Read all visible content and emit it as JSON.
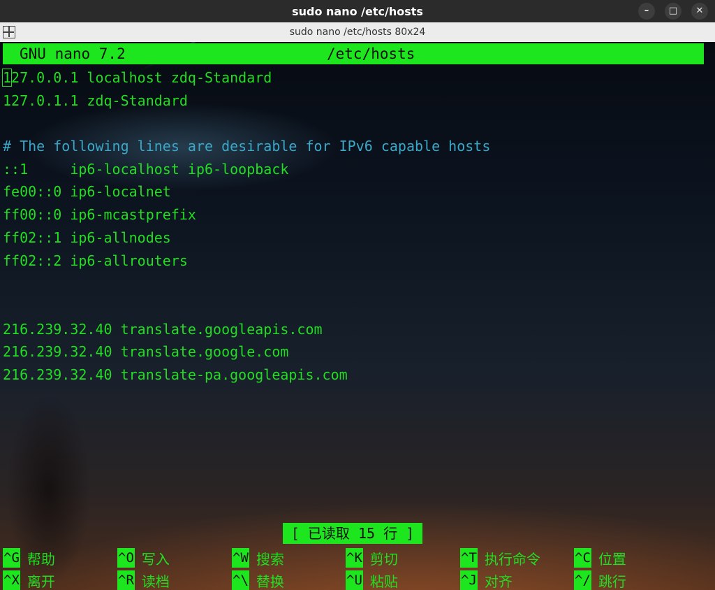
{
  "window": {
    "title": "sudo nano /etc/hosts"
  },
  "tab": {
    "title": "sudo nano /etc/hosts 80x24"
  },
  "nano": {
    "version": "GNU nano 7.2",
    "filename": "/etc/hosts",
    "lines": [
      "127.0.0.1 localhost zdq-Standard",
      "127.0.1.1 zdq-Standard",
      "",
      "# The following lines are desirable for IPv6 capable hosts",
      "::1     ip6-localhost ip6-loopback",
      "fe00::0 ip6-localnet",
      "ff00::0 ip6-mcastprefix",
      "ff02::1 ip6-allnodes",
      "ff02::2 ip6-allrouters",
      "",
      "",
      "216.239.32.40 translate.googleapis.com",
      "216.239.32.40 translate.google.com",
      "216.239.32.40 translate-pa.googleapis.com"
    ],
    "status": "[ 已读取 15 行 ]",
    "shortcuts_row1": [
      {
        "key": "^G",
        "label": "帮助"
      },
      {
        "key": "^O",
        "label": "写入"
      },
      {
        "key": "^W",
        "label": "搜索"
      },
      {
        "key": "^K",
        "label": "剪切"
      },
      {
        "key": "^T",
        "label": "执行命令"
      },
      {
        "key": "^C",
        "label": "位置"
      }
    ],
    "shortcuts_row2": [
      {
        "key": "^X",
        "label": "离开"
      },
      {
        "key": "^R",
        "label": "读档"
      },
      {
        "key": "^\\",
        "label": "替换"
      },
      {
        "key": "^U",
        "label": "粘贴"
      },
      {
        "key": "^J",
        "label": "对齐"
      },
      {
        "key": "^/",
        "label": "跳行"
      }
    ]
  },
  "colors": {
    "accent": "#1ee61e",
    "text": "#22dd22",
    "comment": "#3aa8c8"
  },
  "icons": {
    "tab": "split-view-icon",
    "minimize": "minimize-icon",
    "maximize": "maximize-icon",
    "close": "close-icon"
  }
}
